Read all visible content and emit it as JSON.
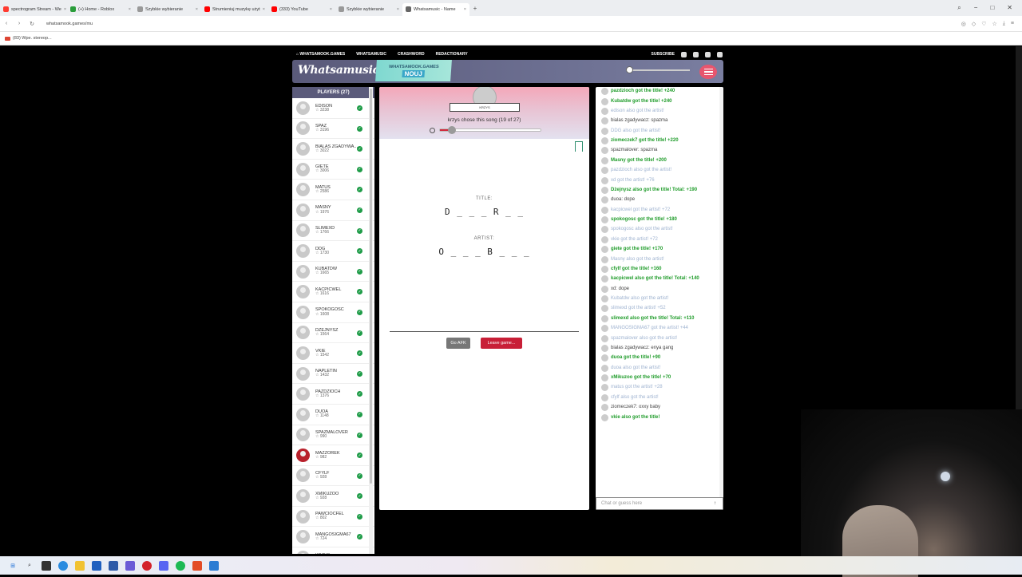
{
  "browser": {
    "tabs": [
      {
        "label": "spectrogram Stream - We",
        "color": "#ff3b30"
      },
      {
        "label": "(+) Home - Roblox",
        "color": "#2a9d3a"
      },
      {
        "label": "Szybkie wybieranie",
        "color": "#999999"
      },
      {
        "label": "Strumieniuj muzykę użyt",
        "color": "#ff0000"
      },
      {
        "label": "(333) YouTube",
        "color": "#ff0000"
      },
      {
        "label": "Szybkie wybieranie",
        "color": "#999999"
      },
      {
        "label": "Whatsamusic - Name",
        "color": "#666666"
      }
    ],
    "url": "whatsamook.games/mu",
    "bookmark": "(83) Wpe. stereop..."
  },
  "topnav": {
    "home": "WHATSAMOOK.GAMES",
    "items": [
      "WHATSAMUSIC",
      "CRASHWORD",
      "REDACTIONARY"
    ],
    "subscribe": "SUBSCRIBE"
  },
  "header": {
    "logo": "Whatsamusic",
    "promo_line1": "WHATSAMOOK.GAMES",
    "promo_line2": "NOUJ"
  },
  "players": {
    "title": "PLAYERS (27)",
    "list": [
      {
        "name": "EDISON",
        "score": "3238"
      },
      {
        "name": "SPAZ",
        "score": "3196"
      },
      {
        "name": "BIALAS ZGADYWA...",
        "score": "3022"
      },
      {
        "name": "GIETE",
        "score": "3006"
      },
      {
        "name": "MATUS",
        "score": "2586"
      },
      {
        "name": "MASNY",
        "score": "1976"
      },
      {
        "name": "SLIMEXD",
        "score": "1766"
      },
      {
        "name": "DDG",
        "score": "1730"
      },
      {
        "name": "KUBATDW",
        "score": "1665"
      },
      {
        "name": "KACPICWEL",
        "score": "1616"
      },
      {
        "name": "SPOKOGOSC",
        "score": "1608"
      },
      {
        "name": "DZEJNYSZ",
        "score": "1564"
      },
      {
        "name": "VKIE",
        "score": "1542"
      },
      {
        "name": "NAPLETIN",
        "score": "1432"
      },
      {
        "name": "PAZDZIOCH",
        "score": "1376"
      },
      {
        "name": "DUOA",
        "score": "1148"
      },
      {
        "name": "SPAZMALOVER",
        "score": "990"
      },
      {
        "name": "MAZZOREK",
        "score": "982"
      },
      {
        "name": "CFYLF",
        "score": "928"
      },
      {
        "name": "XMIKUZOO",
        "score": "928"
      },
      {
        "name": "PAWCIOCFEL",
        "score": "802"
      },
      {
        "name": "MANGOSIGMA67",
        "score": "724"
      },
      {
        "name": "KRZYS",
        "score": ""
      }
    ]
  },
  "game": {
    "dj_name": "KRZYS",
    "chose_text": "krzys chose this song (19 of 27)",
    "progress": 0.12,
    "title_label": "TITLE:",
    "title_hint": "D _ _ _   R _ _",
    "artist_label": "ARTIST:",
    "artist_hint": "O _ _ _   B _ _ _",
    "afk_button": "Go AFK",
    "leave_button": "Leave game..."
  },
  "chat": {
    "messages": [
      {
        "text": "pazdzioch got the title! +240",
        "style": "green"
      },
      {
        "text": "Kubatdw got the title! +240",
        "style": "green"
      },
      {
        "text": "edison also got the artist!",
        "style": "faded"
      },
      {
        "text": "bialas zgadywacz: spazma",
        "style": "plain"
      },
      {
        "text": "DDG also got the artist!",
        "style": "faded"
      },
      {
        "text": "ziomeczek7 got the title! +220",
        "style": "green"
      },
      {
        "text": "spazmalover: spazma",
        "style": "plain"
      },
      {
        "text": "Masny got the title! +200",
        "style": "green"
      },
      {
        "text": "pazdzioch also got the artist!",
        "style": "faded"
      },
      {
        "text": "xd got the artist! +76",
        "style": "faded"
      },
      {
        "text": "Dżejnysz also got the title! Total: +190",
        "style": "green"
      },
      {
        "text": "duoa: dope",
        "style": "plain"
      },
      {
        "text": "kacpicwel got the artist! +72",
        "style": "faded"
      },
      {
        "text": "spokogosc got the title! +180",
        "style": "green"
      },
      {
        "text": "spokogosc also got the artist!",
        "style": "faded"
      },
      {
        "text": "vkie got the artist! +72",
        "style": "faded"
      },
      {
        "text": "giete got the title! +170",
        "style": "green"
      },
      {
        "text": "Masny also got the artist!",
        "style": "faded"
      },
      {
        "text": "cfylf got the title! +160",
        "style": "green"
      },
      {
        "text": "kacpicwel also got the title! Total: +140",
        "style": "green"
      },
      {
        "text": "xd: dope",
        "style": "plain"
      },
      {
        "text": "Kubatdw also got the artist!",
        "style": "faded"
      },
      {
        "text": "slimexd got the artist! +52",
        "style": "faded"
      },
      {
        "text": "slimexd also got the title! Total: +110",
        "style": "green"
      },
      {
        "text": "MANGOSIGMA67 got the artist! +44",
        "style": "faded"
      },
      {
        "text": "spazmalover also got the artist!",
        "style": "faded"
      },
      {
        "text": "bialas zgadywacz: enya gang",
        "style": "plain"
      },
      {
        "text": "duoa got the title! +90",
        "style": "green"
      },
      {
        "text": "duoa also got the artist!",
        "style": "faded"
      },
      {
        "text": "xMikuzoo got the title! +70",
        "style": "green"
      },
      {
        "text": "matus got the artist! +28",
        "style": "faded"
      },
      {
        "text": "cfylf also got the artist!",
        "style": "faded"
      },
      {
        "text": "ziomeczek7: oxxy baby",
        "style": "plain"
      },
      {
        "text": "vkie also got the title!",
        "style": "green"
      }
    ],
    "input_placeholder": "Chat or guess here"
  }
}
